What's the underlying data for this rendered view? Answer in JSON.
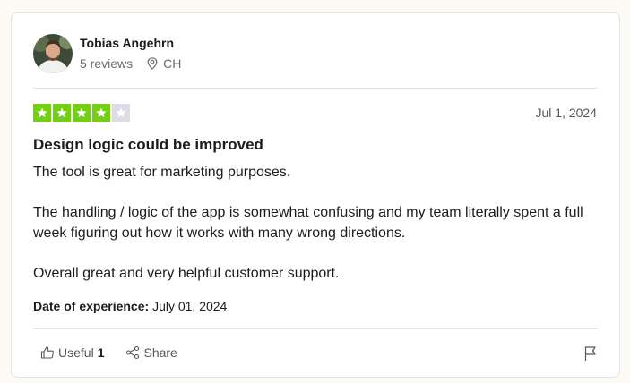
{
  "reviewer": {
    "name": "Tobias Angehrn",
    "reviews_count": "5 reviews",
    "country": "CH",
    "avatar_icon": "user-photo"
  },
  "review": {
    "rating": 4,
    "rating_max": 5,
    "date": "Jul 1, 2024",
    "title": "Design logic could be improved",
    "paragraphs": [
      "The tool is great for marketing purposes.",
      "The handling / logic of the app is somewhat confusing and my team literally spent a full week figuring out how it works with many wrong directions.",
      "Overall great and very helpful customer support."
    ],
    "experience_label": "Date of experience:",
    "experience_date": "July 01, 2024"
  },
  "actions": {
    "useful_label": "Useful",
    "useful_count": "1",
    "share_label": "Share",
    "flag_icon": "flag-icon"
  },
  "colors": {
    "star_filled": "#73cf11",
    "star_empty": "#dcdce6",
    "background": "#fbfaf5"
  }
}
